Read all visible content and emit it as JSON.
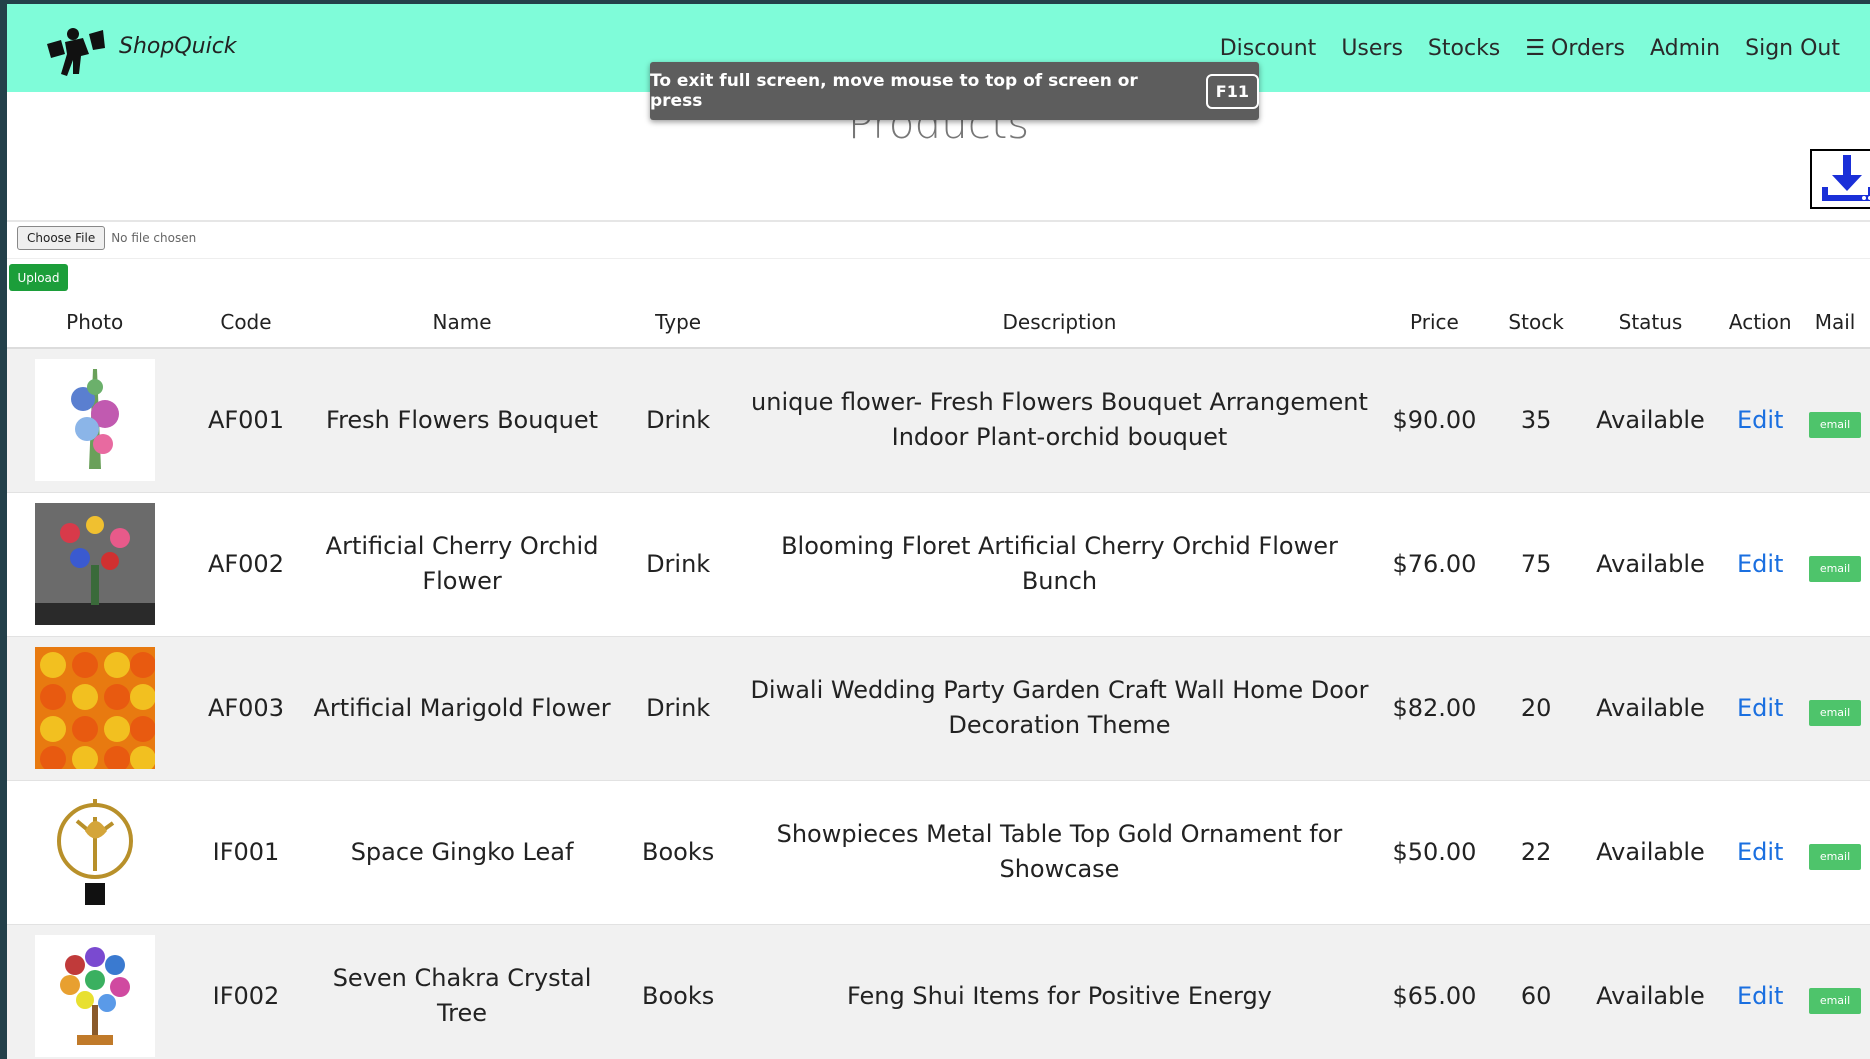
{
  "navbar": {
    "brand": "ShopQuick",
    "links": [
      {
        "label": "Discount"
      },
      {
        "label": "Users"
      },
      {
        "label": "Stocks"
      },
      {
        "label": "Orders"
      },
      {
        "label": "Admin"
      },
      {
        "label": "Sign Out"
      }
    ]
  },
  "page": {
    "title": "Products"
  },
  "fullscreen_toast": {
    "message": "To exit full screen, move mouse to top of screen or press",
    "key": "F11"
  },
  "upload": {
    "choose_label": "Choose File",
    "file_status": "No file chosen",
    "upload_label": "Upload"
  },
  "table": {
    "headers": [
      "Photo",
      "Code",
      "Name",
      "Type",
      "Description",
      "Price",
      "Stock",
      "Status",
      "Action",
      "Mail"
    ],
    "rows": [
      {
        "code": "AF001",
        "name": "Fresh Flowers Bouquet",
        "type": "Drink",
        "description": "unique flower- Fresh Flowers Bouquet Arrangement Indoor Plant-orchid bouquet",
        "price": "$90.00",
        "stock": "35",
        "status": "Available",
        "action": "Edit",
        "mail": "email"
      },
      {
        "code": "AF002",
        "name": "Artificial Cherry Orchid Flower",
        "type": "Drink",
        "description": "Blooming Floret Artificial Cherry Orchid Flower Bunch",
        "price": "$76.00",
        "stock": "75",
        "status": "Available",
        "action": "Edit",
        "mail": "email"
      },
      {
        "code": "AF003",
        "name": "Artificial Marigold Flower",
        "type": "Drink",
        "description": "Diwali Wedding Party Garden Craft Wall Home Door Decoration Theme",
        "price": "$82.00",
        "stock": "20",
        "status": "Available",
        "action": "Edit",
        "mail": "email"
      },
      {
        "code": "IF001",
        "name": "Space Gingko Leaf",
        "type": "Books",
        "description": "Showpieces Metal Table Top Gold Ornament for Showcase",
        "price": "$50.00",
        "stock": "22",
        "status": "Available",
        "action": "Edit",
        "mail": "email"
      },
      {
        "code": "IF002",
        "name": "Seven Chakra Crystal Tree",
        "type": "Books",
        "description": "Feng Shui Items for Positive Energy",
        "price": "$65.00",
        "stock": "60",
        "status": "Available",
        "action": "Edit",
        "mail": "email"
      }
    ]
  },
  "colors": {
    "navbar": "#7ffcd9",
    "upload": "#1c9e3a",
    "email": "#4ec46b",
    "edit": "#1a6fe0"
  }
}
